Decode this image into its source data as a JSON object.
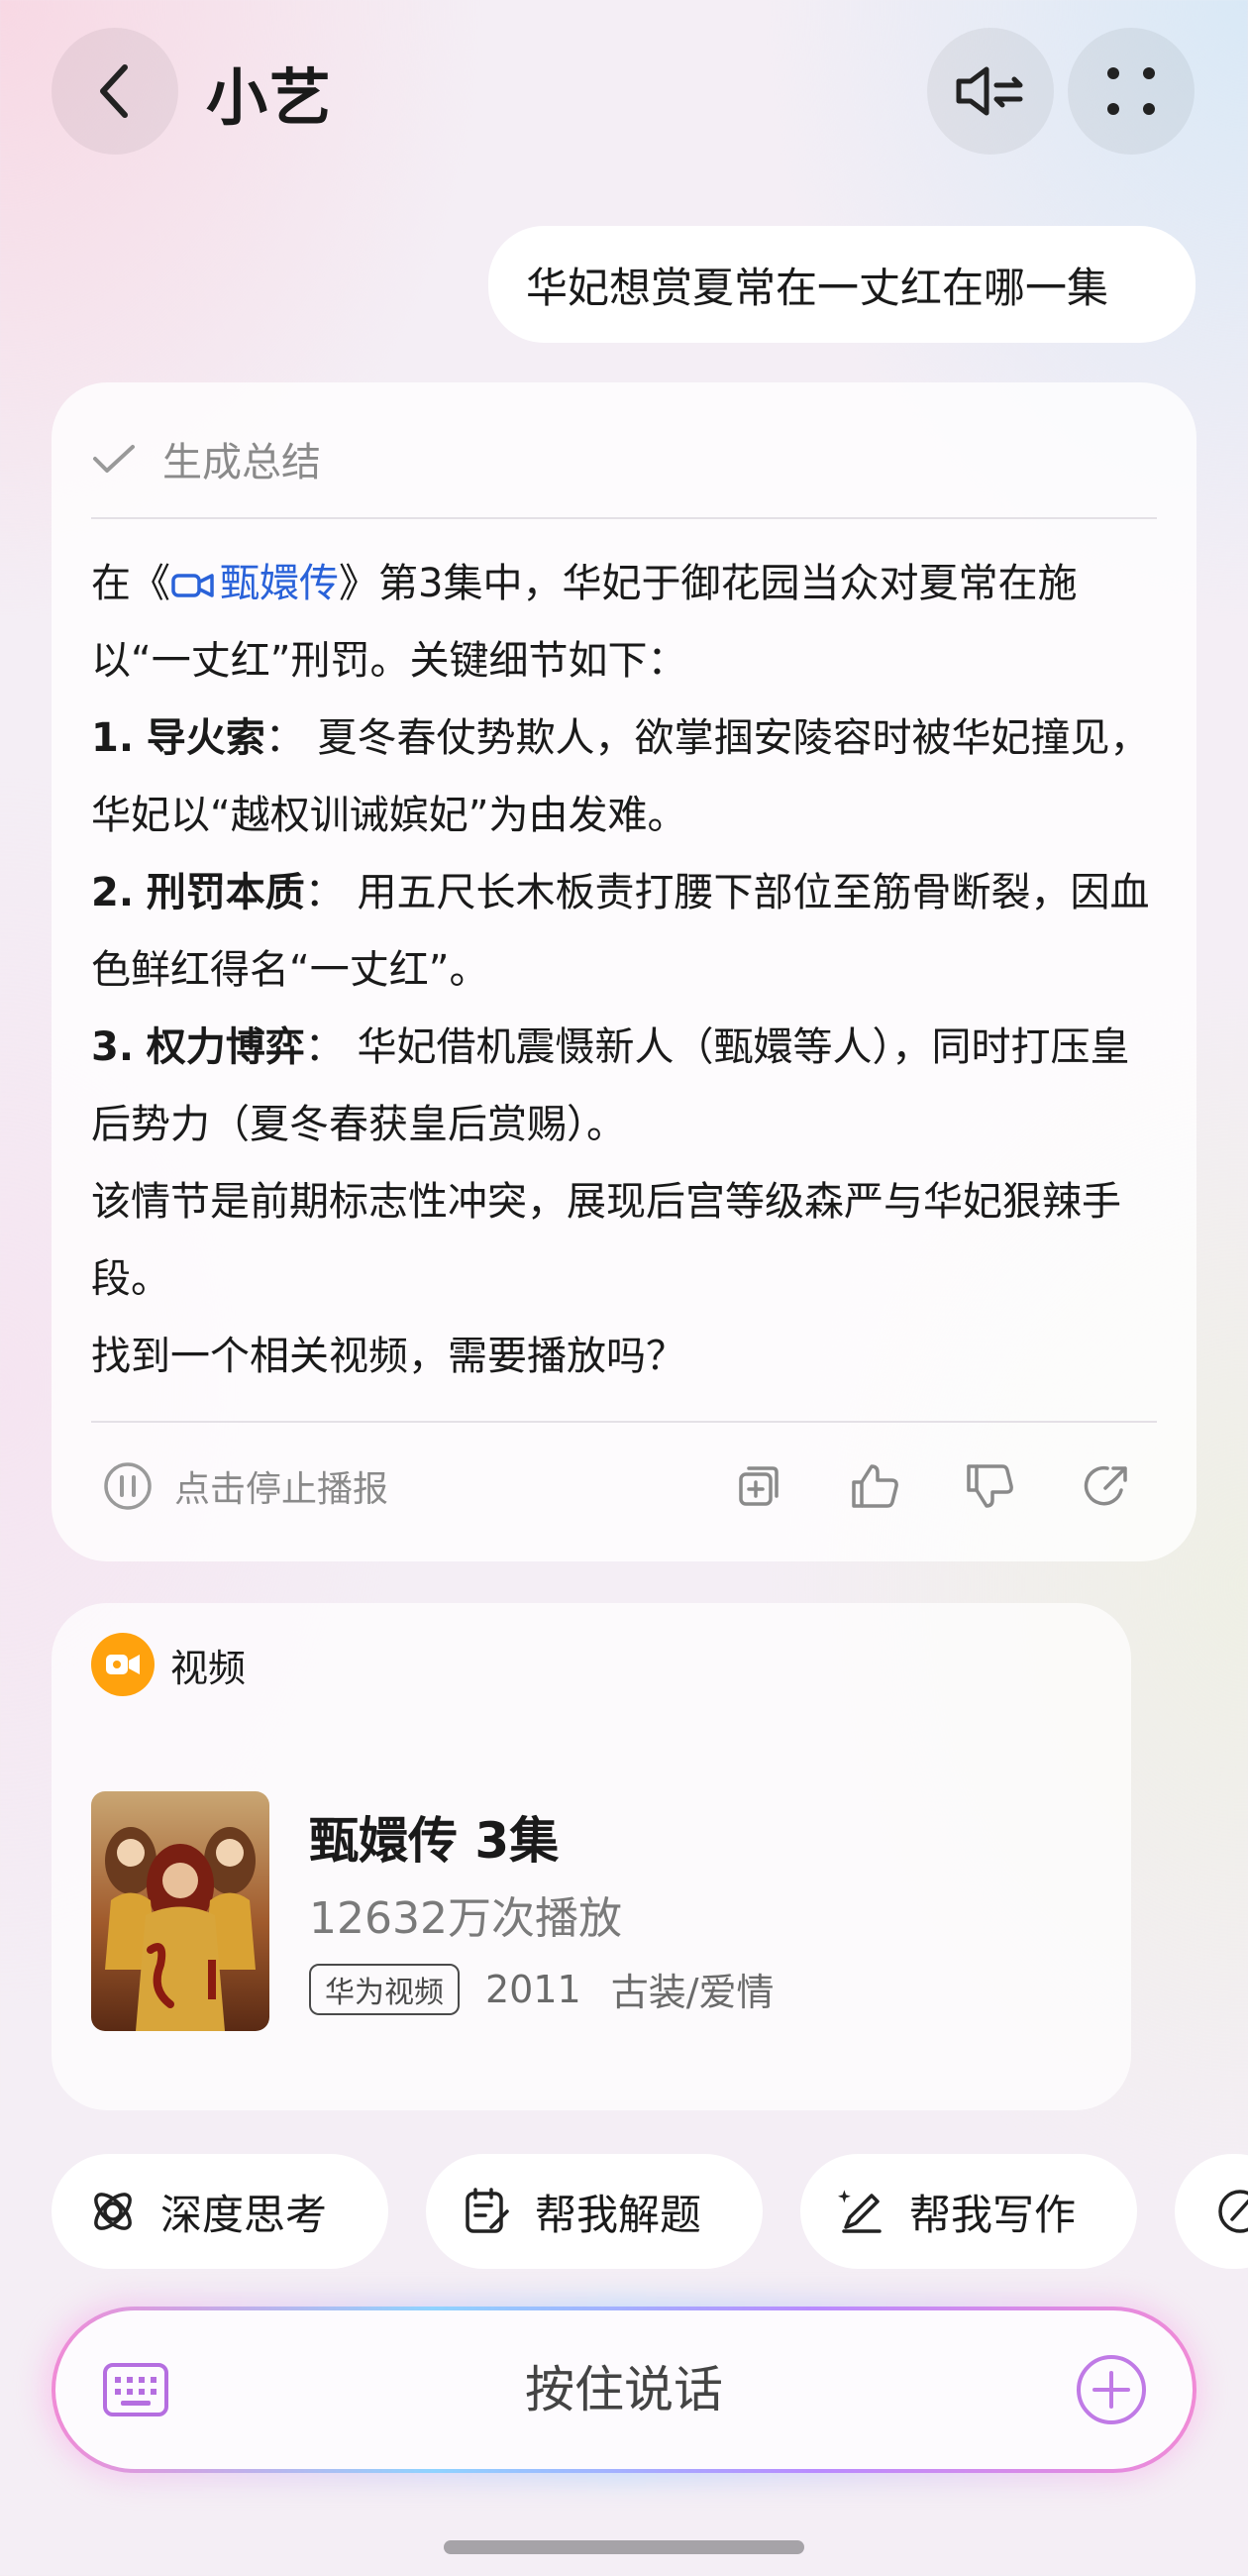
{
  "header": {
    "title": "小艺"
  },
  "user_message": "华妃想赏夏常在一丈红在哪一集",
  "answer": {
    "summary_label": "生成总结",
    "intro_pre": "在《",
    "intro_link": "甄嬛传",
    "intro_post": "》第3集中，华妃于御花园当众对夏常在施以“一丈红”刑罚。关键细节如下：",
    "points": [
      {
        "num": "1.",
        "title": "导火索",
        "sep": "：",
        "text": "夏冬春仗势欺人，欲掌掴安陵容时被华妃撞见，华妃以“越权训诫嫔妃”为由发难。"
      },
      {
        "num": "2.",
        "title": "刑罚本质",
        "sep": "：",
        "text": "用五尺长木板责打腰下部位至筋骨断裂，因血色鲜红得名“一丈红”。"
      },
      {
        "num": "3.",
        "title": "权力博弈",
        "sep": "：",
        "text": "华妃借机震慑新人（甄嬛等人），同时打压皇后势力（夏冬春获皇后赏赐）。"
      }
    ],
    "conclusion": "该情节是前期标志性冲突，展现后宫等级森严与华妃狠辣手段。",
    "question": "找到一个相关视频，需要播放吗？",
    "stop_label": "点击停止播报"
  },
  "video_card": {
    "header_label": "视频",
    "title": "甄嬛传 3集",
    "plays": "12632万次播放",
    "source_tag": "华为视频",
    "year": "2011",
    "genre": "古装/爱情"
  },
  "chips": [
    {
      "label": "深度思考",
      "icon": "deep-think-icon"
    },
    {
      "label": "帮我解题",
      "icon": "solve-icon"
    },
    {
      "label": "帮我写作",
      "icon": "write-icon"
    }
  ],
  "input_bar": {
    "label": "按住说话"
  },
  "colors": {
    "link": "#2962d9",
    "video_icon": "#ffa20d",
    "keyboard_icon": "#b56ee0"
  }
}
